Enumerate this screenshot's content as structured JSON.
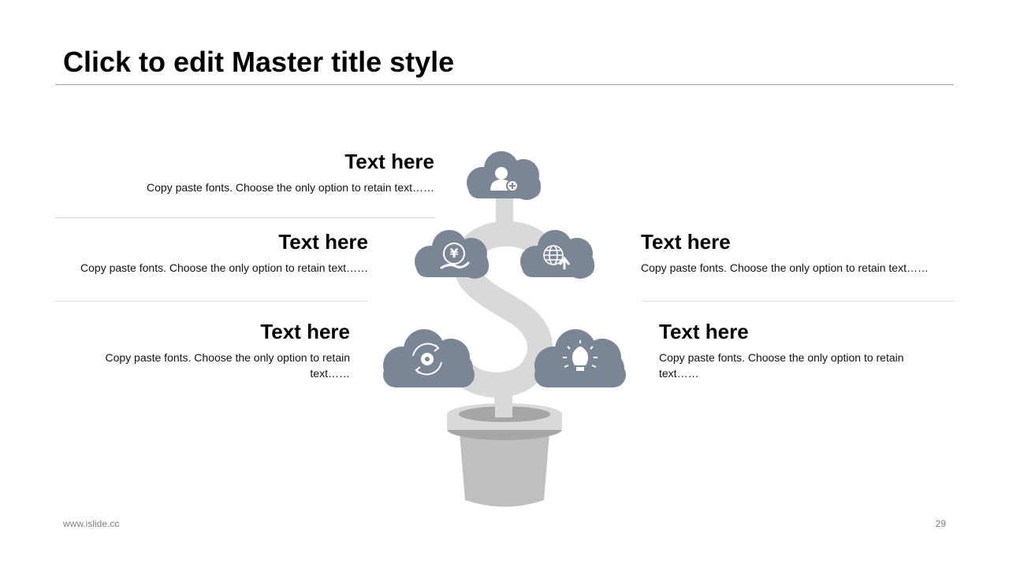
{
  "slide": {
    "title": "Click to edit Master title style",
    "footer_url": "www.islide.cc",
    "page_number": "29"
  },
  "blocks": {
    "top_left": {
      "heading": "Text here",
      "body": "Copy paste fonts. Choose the only option to retain text……"
    },
    "mid_left": {
      "heading": "Text here",
      "body": "Copy paste fonts. Choose the only option to retain text……"
    },
    "bottom_left": {
      "heading": "Text here",
      "body": "Copy paste fonts. Choose the only option to retain text……"
    },
    "mid_right": {
      "heading": "Text here",
      "body": "Copy paste fonts. Choose the only option to retain text……"
    },
    "bottom_right": {
      "heading": "Text here",
      "body": "Copy paste fonts. Choose the only option to retain text……"
    }
  },
  "icons": {
    "cloud_top": "add-user-icon",
    "cloud_mid_left": "yen-hand-icon",
    "cloud_mid_right": "globe-upload-icon",
    "cloud_bottom_left": "gear-cycle-icon",
    "cloud_bottom_right": "lightbulb-icon"
  },
  "colors": {
    "cloud": "#7a8596",
    "stem": "#d9d9d9",
    "pot": "#bfbfbf",
    "pot_rim": "#a6a6a6"
  }
}
